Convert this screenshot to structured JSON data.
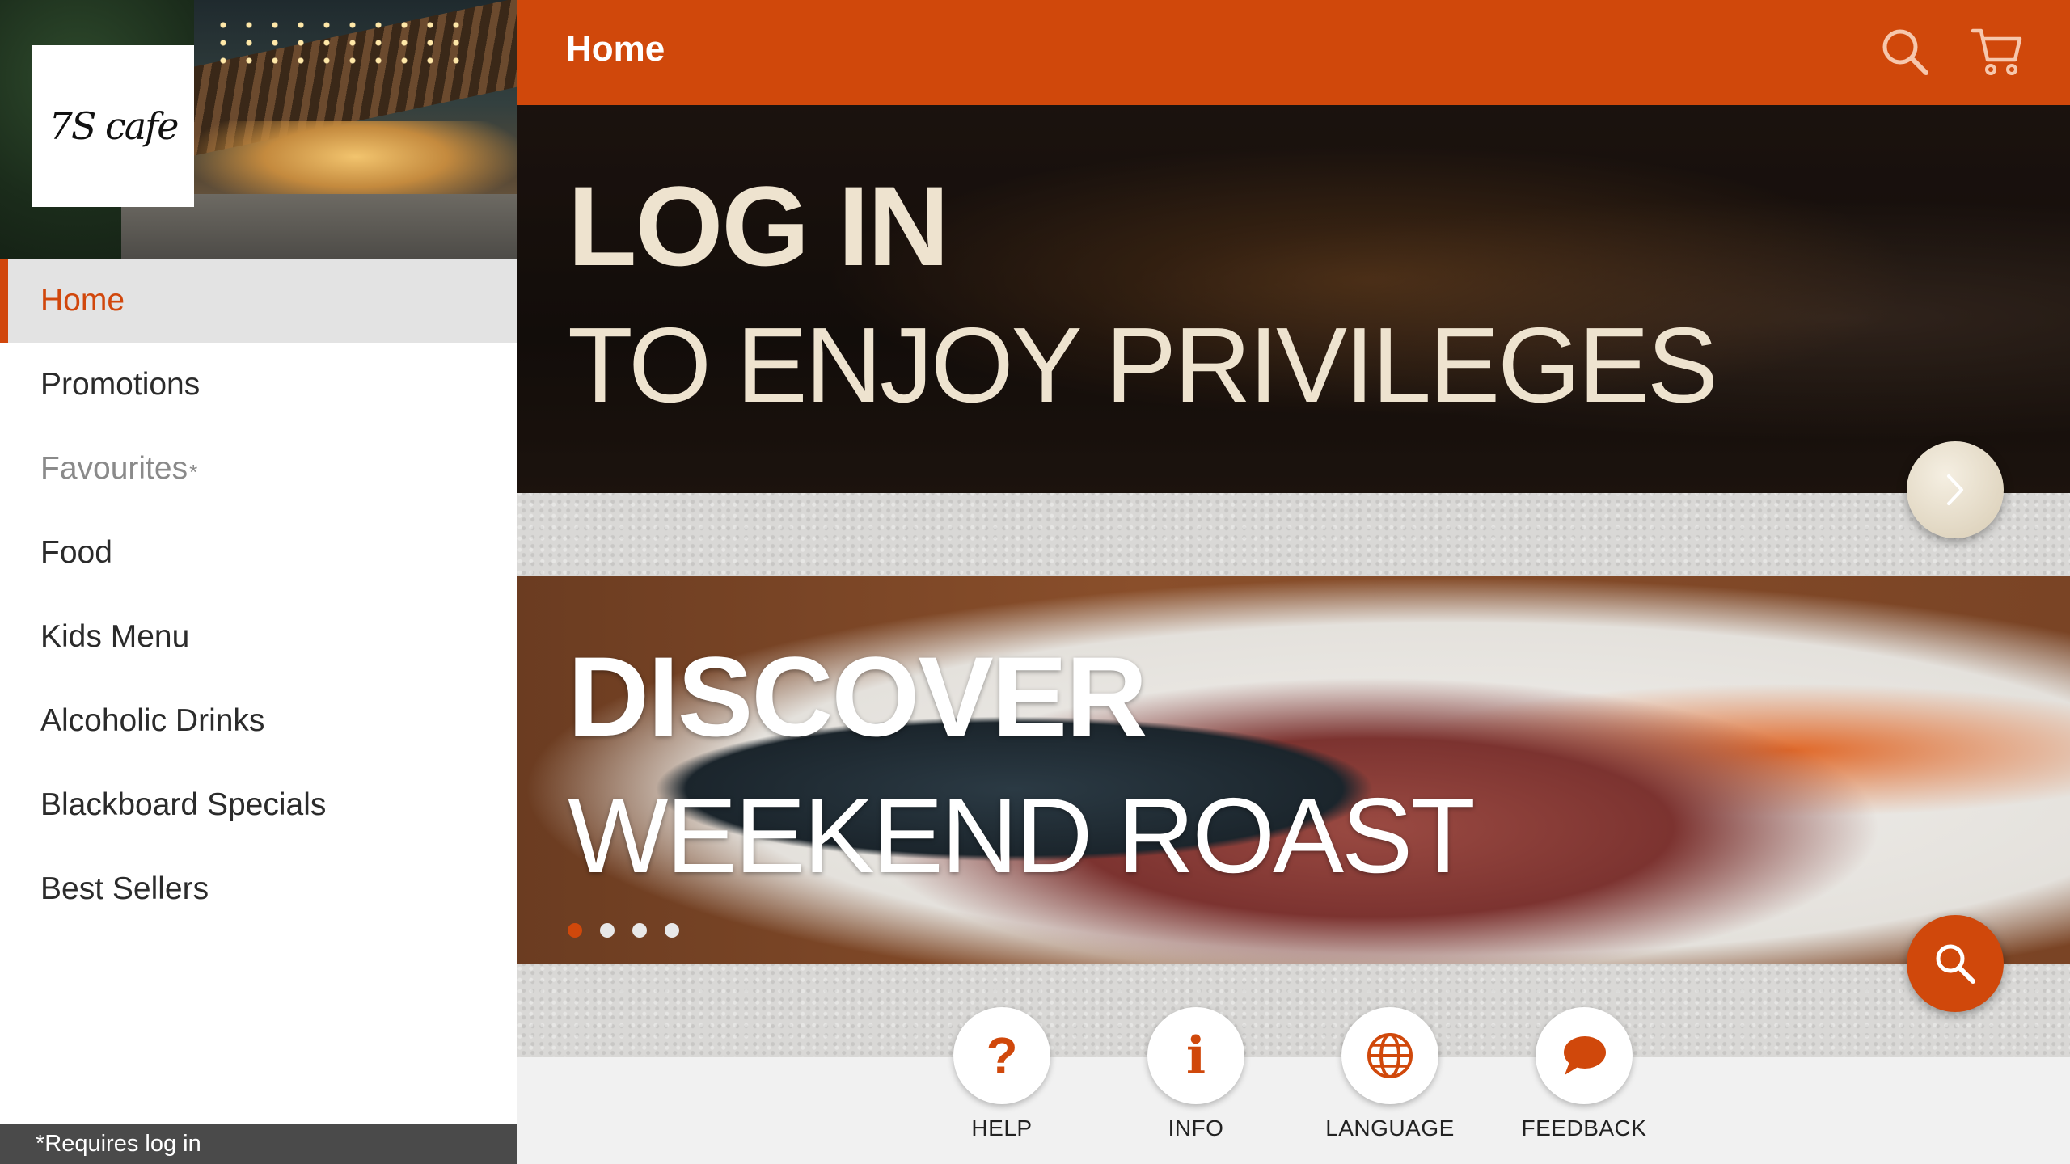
{
  "app": {
    "brand_logo_text": "7S cafe",
    "accent_color": "#d0480b"
  },
  "topbar": {
    "title": "Home",
    "icons": [
      "search-icon",
      "cart-icon"
    ]
  },
  "sidebar": {
    "items": [
      {
        "label": "Home",
        "active": true
      },
      {
        "label": "Promotions"
      },
      {
        "label": "Favourites",
        "suffix": "*",
        "requires_login": true
      },
      {
        "label": "Food"
      },
      {
        "label": "Kids Menu"
      },
      {
        "label": "Alcoholic Drinks"
      },
      {
        "label": "Blackboard Specials"
      },
      {
        "label": "Best Sellers"
      }
    ],
    "footer_note": "*Requires log in"
  },
  "banners": [
    {
      "line1": "LOG IN",
      "line2": "TO ENJOY PRIVILEGES"
    },
    {
      "line1": "DISCOVER",
      "line2": "WEEKEND ROAST"
    }
  ],
  "carousel": {
    "total": 4,
    "active_index": 0
  },
  "bottom_actions": [
    {
      "label": "HELP",
      "icon": "help-icon",
      "glyph": "?"
    },
    {
      "label": "INFO",
      "icon": "info-icon",
      "glyph": "i"
    },
    {
      "label": "LANGUAGE",
      "icon": "globe-icon"
    },
    {
      "label": "FEEDBACK",
      "icon": "chat-bubble-icon"
    }
  ]
}
